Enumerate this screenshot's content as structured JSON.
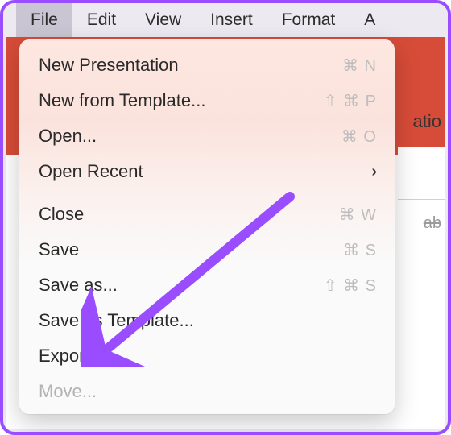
{
  "menubar": {
    "items": [
      "File",
      "Edit",
      "View",
      "Insert",
      "Format",
      "A"
    ],
    "active_index": 0
  },
  "dropdown": {
    "groups": [
      [
        {
          "label": "New Presentation",
          "shortcut": "⌘ N",
          "submenu": false,
          "disabled": false
        },
        {
          "label": "New from Template...",
          "shortcut": "⇧ ⌘ P",
          "submenu": false,
          "disabled": false
        },
        {
          "label": "Open...",
          "shortcut": "⌘ O",
          "submenu": false,
          "disabled": false
        },
        {
          "label": "Open Recent",
          "shortcut": "",
          "submenu": true,
          "disabled": false
        }
      ],
      [
        {
          "label": "Close",
          "shortcut": "⌘ W",
          "submenu": false,
          "disabled": false
        },
        {
          "label": "Save",
          "shortcut": "⌘ S",
          "submenu": false,
          "disabled": false
        },
        {
          "label": "Save as...",
          "shortcut": "⇧ ⌘ S",
          "submenu": false,
          "disabled": false
        },
        {
          "label": "Save as Template...",
          "shortcut": "",
          "submenu": false,
          "disabled": false
        },
        {
          "label": "Export...",
          "shortcut": "",
          "submenu": false,
          "disabled": false
        },
        {
          "label": "Move...",
          "shortcut": "",
          "submenu": false,
          "disabled": true
        }
      ]
    ]
  },
  "background": {
    "word_fragment": "atio",
    "strike_fragment": "ab"
  },
  "annotation": {
    "arrow_color": "#9A4DFF"
  }
}
